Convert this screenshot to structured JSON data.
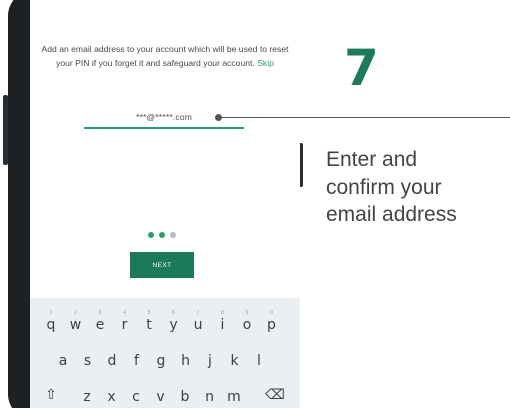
{
  "screen": {
    "info_text": "Add an email address to your account which will be used to reset your PIN if you forget it and safeguard your account.",
    "skip_link": "Skip",
    "email_value": "***@*****.com",
    "pager": {
      "total": 3,
      "active": [
        0,
        1
      ],
      "colors": {
        "active": "#2a9d6b",
        "inactive": "#b0bec5"
      }
    },
    "next_button": "NEXT",
    "accent_color": "#2a9d6b",
    "button_color": "#1c7a5a"
  },
  "keyboard": {
    "row1": [
      {
        "key": "q",
        "hint": "1"
      },
      {
        "key": "w",
        "hint": "2"
      },
      {
        "key": "e",
        "hint": "3"
      },
      {
        "key": "r",
        "hint": "4"
      },
      {
        "key": "t",
        "hint": "5"
      },
      {
        "key": "y",
        "hint": "6"
      },
      {
        "key": "u",
        "hint": "7"
      },
      {
        "key": "i",
        "hint": "8"
      },
      {
        "key": "o",
        "hint": "9"
      },
      {
        "key": "p",
        "hint": "0"
      }
    ],
    "row2": [
      "a",
      "s",
      "d",
      "f",
      "g",
      "h",
      "j",
      "k",
      "l"
    ],
    "row3": [
      "z",
      "x",
      "c",
      "v",
      "b",
      "n",
      "m"
    ],
    "shift_icon": "shift-icon",
    "backspace_icon": "backspace-icon"
  },
  "panel": {
    "step_number": "7",
    "caption_lines": [
      "Enter and",
      "confirm your",
      "email address"
    ],
    "step_color": "#1a7a5a"
  }
}
